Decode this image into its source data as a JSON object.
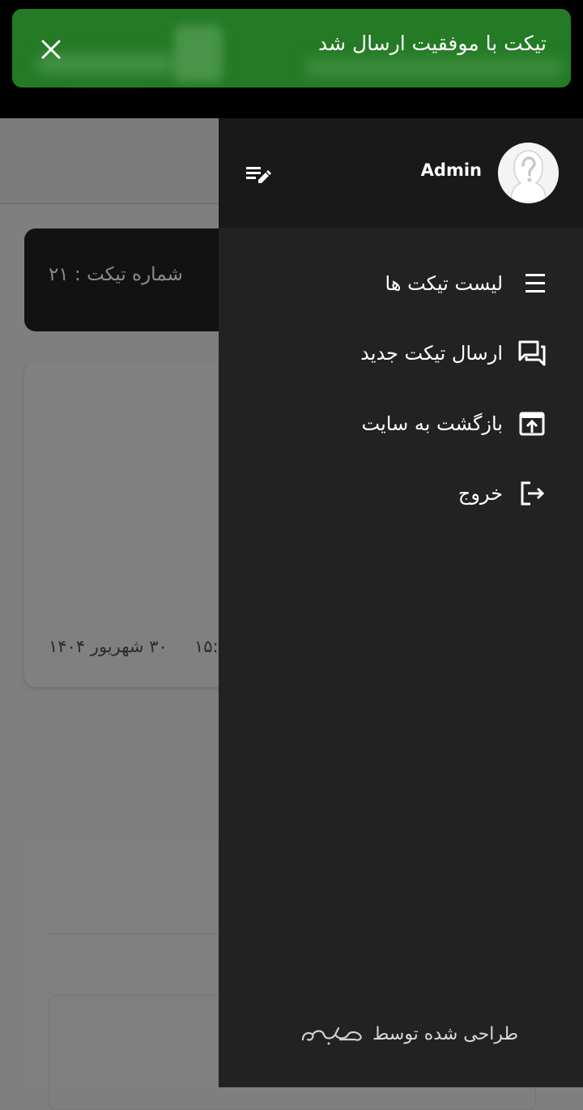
{
  "toast": {
    "message": "تیکت با موفقیت ارسال شد",
    "color": "#247a25"
  },
  "background": {
    "ticket_number_label": "شماره تیکت : ۲۱",
    "ticket_time": "۱۵:",
    "ticket_date": "۳۰ شهریور ۱۴۰۴"
  },
  "drawer": {
    "user_name": "Admin",
    "menu": [
      {
        "label": "لیست تیکت ها",
        "icon": "list-numbered-icon"
      },
      {
        "label": "ارسال تیکت جدید",
        "icon": "chat-bubbles-icon"
      },
      {
        "label": "بازگشت به سایت",
        "icon": "open-in-browser-icon"
      },
      {
        "label": "خروج",
        "icon": "logout-icon"
      }
    ],
    "footer_credit": "طراحی شده توسط"
  }
}
